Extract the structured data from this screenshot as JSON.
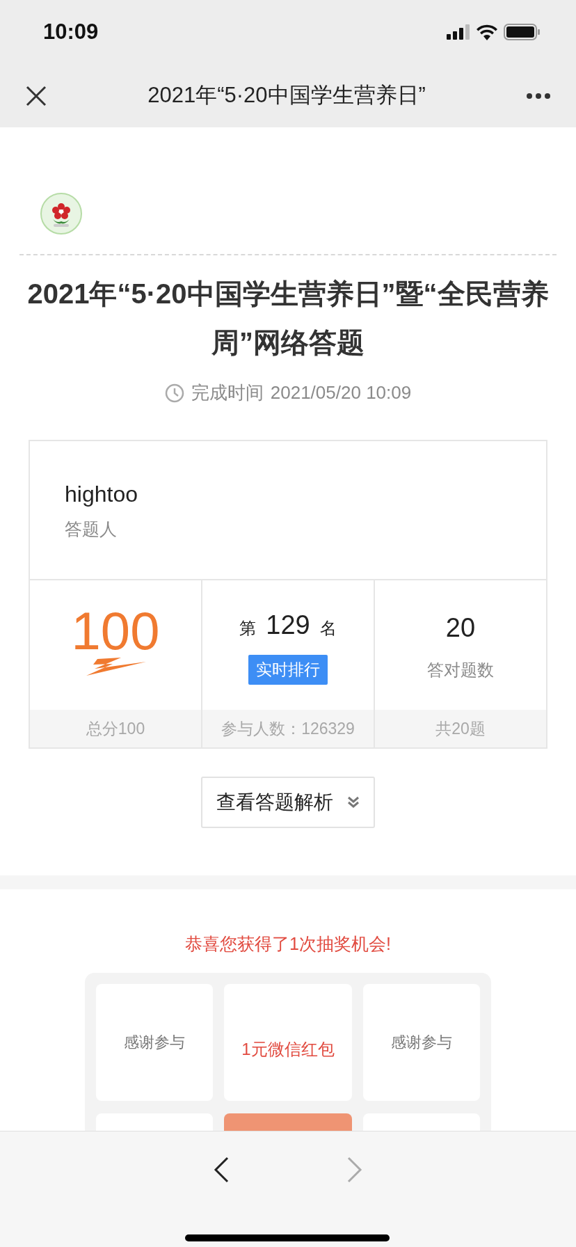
{
  "status_bar": {
    "time": "10:09"
  },
  "nav_bar": {
    "title": "2021年“5·20中国学生营养日”"
  },
  "quiz": {
    "title": "2021年“5·20中国学生营养日”暨“全民营养周”网络答题",
    "time_label": "完成时间",
    "time_value": "2021/05/20 10:09"
  },
  "result": {
    "name": "hightoo",
    "name_label": "答题人",
    "stats": [
      {
        "kind": "score",
        "value": "100",
        "footer": "总分100"
      },
      {
        "kind": "rank",
        "prefix": "第",
        "value": "129",
        "suffix": "名",
        "button": "实时排行",
        "footer": "参与人数：126329"
      },
      {
        "kind": "count",
        "value": "20",
        "label": "答对题数",
        "footer": "共20题"
      }
    ]
  },
  "analysis_button": "查看答题解析",
  "lottery": {
    "message": "恭喜您获得了1次抽奖机会!",
    "cells": [
      {
        "label": "感谢参与",
        "highlight": false,
        "selected": false
      },
      {
        "label": "1元微信红包",
        "highlight": true,
        "selected": false
      },
      {
        "label": "感谢参与",
        "highlight": false,
        "selected": false
      },
      {
        "selected": false
      },
      {
        "selected": true
      },
      {
        "selected": false
      }
    ]
  }
}
